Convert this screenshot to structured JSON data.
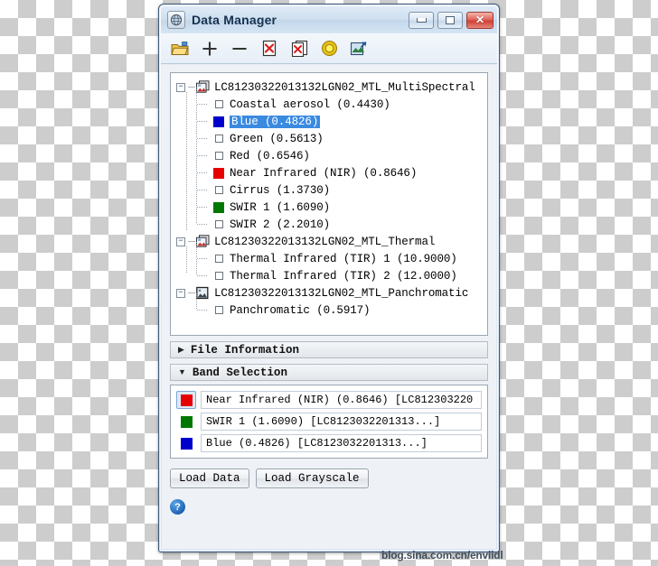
{
  "window": {
    "title": "Data Manager",
    "app_icon": "globe-icon",
    "minimize_label": "–",
    "maximize_label": "□",
    "close_label": "✕"
  },
  "toolbar": {
    "items": [
      {
        "name": "open-folder-icon",
        "tooltip": "Open File"
      },
      {
        "name": "plus-icon",
        "tooltip": "Add"
      },
      {
        "name": "minus-icon",
        "tooltip": "Remove"
      },
      {
        "name": "close-file-icon",
        "tooltip": "Close File"
      },
      {
        "name": "close-all-files-icon",
        "tooltip": "Close All Files"
      },
      {
        "name": "yellow-gear-icon",
        "tooltip": "Properties"
      },
      {
        "name": "load-image-icon",
        "tooltip": "Load Image"
      }
    ]
  },
  "tree": {
    "groups": [
      {
        "label": "LC81230322013132LGN02_MTL_MultiSpectral",
        "icon": "multilayer-image-icon",
        "expanded": true,
        "expander": "−",
        "bands": [
          {
            "label": "Coastal aerosol  (0.4430)",
            "color": null,
            "selected": false
          },
          {
            "label": "Blue  (0.4826)",
            "color": "#0000CC",
            "selected": true
          },
          {
            "label": "Green  (0.5613)",
            "color": null,
            "selected": false
          },
          {
            "label": "Red  (0.6546)",
            "color": null,
            "selected": false
          },
          {
            "label": "Near Infrared (NIR)  (0.8646)",
            "color": "#E60000",
            "selected": false
          },
          {
            "label": "Cirrus  (1.3730)",
            "color": null,
            "selected": false
          },
          {
            "label": "SWIR 1  (1.6090)",
            "color": "#007700",
            "selected": false
          },
          {
            "label": "SWIR 2  (2.2010)",
            "color": null,
            "selected": false
          }
        ]
      },
      {
        "label": "LC81230322013132LGN02_MTL_Thermal",
        "icon": "multilayer-image-icon",
        "expanded": true,
        "expander": "−",
        "bands": [
          {
            "label": "Thermal Infrared (TIR) 1  (10.9000)",
            "color": null,
            "selected": false
          },
          {
            "label": "Thermal Infrared (TIR) 2  (12.0000)",
            "color": null,
            "selected": false
          }
        ]
      },
      {
        "label": "LC81230322013132LGN02_MTL_Panchromatic",
        "icon": "single-image-icon",
        "expanded": true,
        "expander": "−",
        "bands": [
          {
            "label": "Panchromatic  (0.5917)",
            "color": null,
            "selected": false
          }
        ]
      }
    ]
  },
  "accordions": [
    {
      "title": "File Information",
      "expanded": false,
      "arrow": "▶"
    },
    {
      "title": "Band Selection",
      "expanded": true,
      "arrow": "▼"
    }
  ],
  "band_selection": {
    "rows": [
      {
        "color": "#E60000",
        "text": "Near Infrared (NIR)  (0.8646)  [LC812303220",
        "active": true
      },
      {
        "color": "#007700",
        "text": "SWIR 1  (1.6090)  [LC8123032201313...]",
        "active": false
      },
      {
        "color": "#0000CC",
        "text": "Blue  (0.4826)  [LC8123032201313...]",
        "active": false
      }
    ]
  },
  "buttons": {
    "load_data": "Load Data",
    "load_grayscale": "Load Grayscale",
    "help": "?"
  },
  "watermark": "blog.sina.com.cn/enviidl"
}
